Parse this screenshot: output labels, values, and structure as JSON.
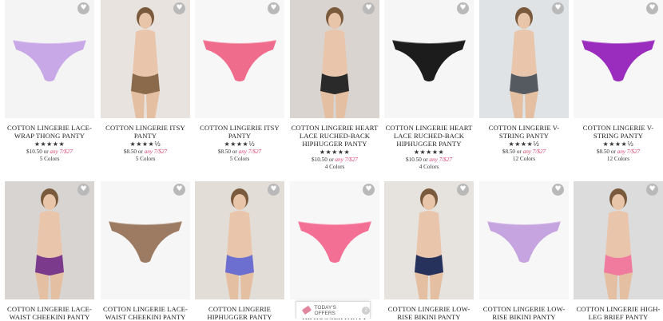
{
  "products": [
    {
      "title": "COTTON LINGERIE LACE-WRAP THONG PANTY",
      "stars": "★★★★★",
      "price": "$10.50 or",
      "deal": "any 7/$27",
      "colors": "5 Colors",
      "image": "lavender-print-thong",
      "bg": "#f4f4f4",
      "accent": "#c8a8e6"
    },
    {
      "title": "COTTON LINGERIE ITSY PANTY",
      "stars": "★★★★½",
      "price": "$8.50 or",
      "deal": "any 7/$27",
      "colors": "5 Colors",
      "image": "model-leopard-back",
      "bg": "#e8e3df",
      "accent": "#8a6a4a"
    },
    {
      "title": "COTTON LINGERIE ITSY PANTY",
      "stars": "★★★★½",
      "price": "$8.50 or",
      "deal": "any 7/$27",
      "colors": "5 Colors",
      "image": "pink-itsy-panty",
      "bg": "#f7f7f7",
      "accent": "#f06c8c"
    },
    {
      "title": "COTTON LINGERIE HEART LACE RUCHED-BACK HIPHUGGER PANTY",
      "stars": "★★★★★",
      "price": "$10.50 or",
      "deal": "any 7/$27",
      "colors": "4 Colors",
      "image": "model-black-lace",
      "bg": "#d9d4d0",
      "accent": "#2a2a2a"
    },
    {
      "title": "COTTON LINGERIE HEART LACE RUCHED-BACK HIPHUGGER PANTY",
      "stars": "★★★★★",
      "price": "$10.50 or",
      "deal": "any 7/$27",
      "colors": "4 Colors",
      "image": "black-lace-panty",
      "bg": "#f6f6f6",
      "accent": "#1c1c1c"
    },
    {
      "title": "COTTON LINGERIE V-STRING PANTY",
      "stars": "★★★★½",
      "price": "$8.50 or",
      "deal": "any 7/$27",
      "colors": "12 Colors",
      "image": "model-gray-vstring",
      "bg": "#dfe3e6",
      "accent": "#555a60"
    },
    {
      "title": "COTTON LINGERIE V-STRING PANTY",
      "stars": "★★★★½",
      "price": "$8.50 or",
      "deal": "any 7/$27",
      "colors": "12 Colors",
      "image": "purple-vstring",
      "bg": "#f7f7f7",
      "accent": "#9a2dbd"
    },
    {
      "title": "COTTON LINGERIE LACE-WAIST CHEEKINI PANTY",
      "stars": "",
      "price": "",
      "deal": "",
      "colors": "",
      "image": "model-purple-cheekini",
      "bg": "#d8d4d2",
      "accent": "#7b3a8c"
    },
    {
      "title": "COTTON LINGERIE LACE-WAIST CHEEKINI PANTY",
      "stars": "",
      "price": "",
      "deal": "",
      "colors": "",
      "image": "leopard-cheekini",
      "bg": "#f6f6f6",
      "accent": "#9d7b63"
    },
    {
      "title": "COTTON LINGERIE HIPHUGGER PANTY",
      "stars": "",
      "price": "",
      "deal": "",
      "colors": "",
      "image": "model-blue-hiphugger",
      "bg": "#e3ddd7",
      "accent": "#6d6fd0"
    },
    {
      "title": "COTTON LINGERIE HIPHUGGER PANTY",
      "stars": "",
      "price": "",
      "deal": "",
      "colors": "",
      "image": "pink-stripe-hiphugger",
      "bg": "#f7f7f7",
      "accent": "#f46f94"
    },
    {
      "title": "COTTON LINGERIE LOW-RISE BIKINI PANTY",
      "stars": "",
      "price": "",
      "deal": "",
      "colors": "",
      "image": "model-navy-bikini",
      "bg": "#e6e2de",
      "accent": "#26325c"
    },
    {
      "title": "COTTON LINGERIE LOW-RISE BIKINI PANTY",
      "stars": "",
      "price": "",
      "deal": "",
      "colors": "",
      "image": "lavender-print-bikini",
      "bg": "#f7f7f7",
      "accent": "#c6a4e0"
    },
    {
      "title": "COTTON LINGERIE HIGH-LEG BRIEF PANTY",
      "stars": "",
      "price": "",
      "deal": "",
      "colors": "",
      "image": "model-pink-brief",
      "bg": "#dcdcdc",
      "accent": "#f17b9e"
    }
  ],
  "offers_tab": {
    "label": "TODAY'S OFFERS",
    "count": "2"
  }
}
